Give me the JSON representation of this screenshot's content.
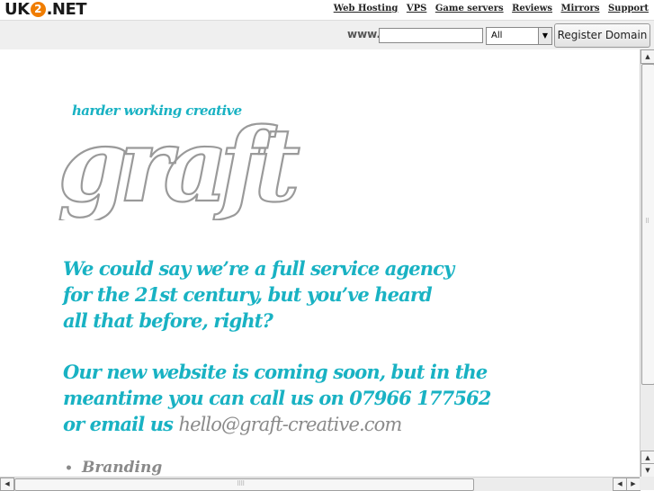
{
  "topbar": {
    "logo_left": "UK",
    "logo_badge": "2",
    "logo_right": ".NET",
    "nav": [
      "Web Hosting",
      "VPS",
      "Game servers",
      "Reviews",
      "Mirrors",
      "Support"
    ]
  },
  "domain_search": {
    "prefix": "www.",
    "input_value": "",
    "tld_selected": "All",
    "register_label": "Register Domain"
  },
  "page": {
    "tagline": "harder working creative",
    "logo_word": "graft",
    "intro_lines": [
      "We could say we’re a full service agency",
      "for the 21st century, but you’ve heard",
      "all that before, right?"
    ],
    "coming_lines": [
      "Our new website is coming soon, but in the",
      "meantime you can call us on 07966 177562",
      "or email us "
    ],
    "email": "hello@graft-creative.com",
    "services": [
      "Branding"
    ]
  },
  "colors": {
    "accent": "#19b2c3",
    "grey_text": "#8a8a8a",
    "badge": "#f07d00"
  }
}
